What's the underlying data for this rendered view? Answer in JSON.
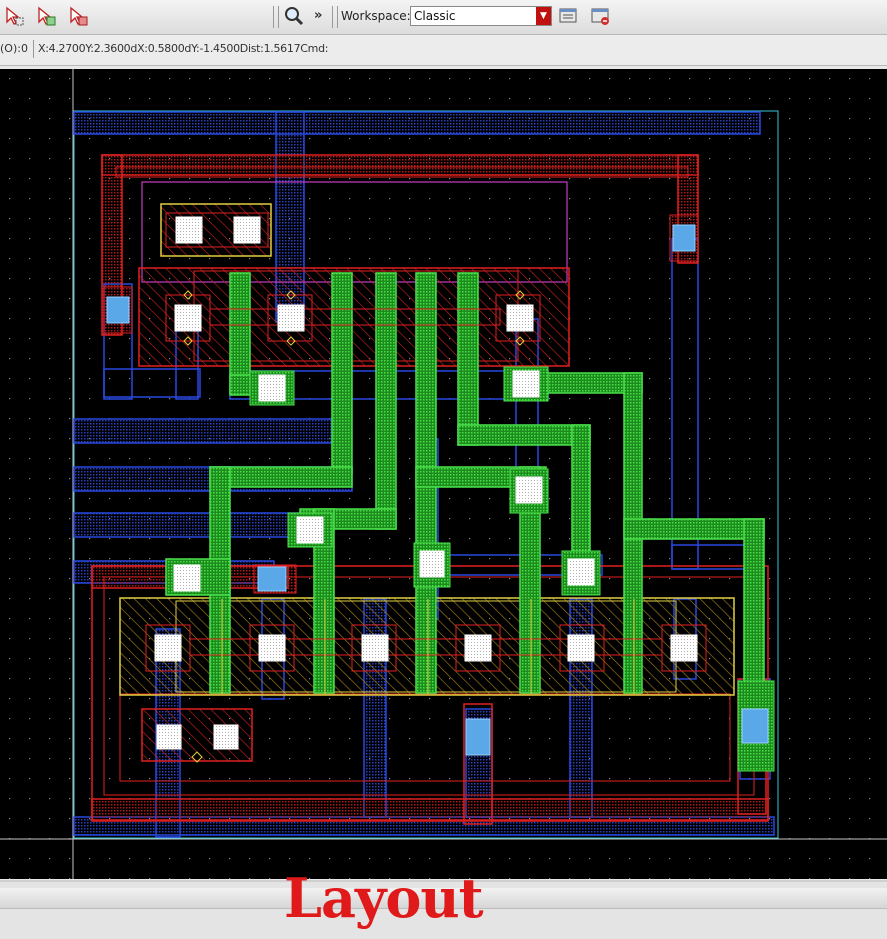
{
  "toolbar": {
    "icons": [
      "select-pointer-icon",
      "select-pointer-add-icon",
      "select-pointer-remove-icon",
      "zoom-icon",
      "workspace-save-icon",
      "workspace-load-icon"
    ],
    "overflow_label": "»",
    "workspace_label": "Workspace:",
    "workspace_value": "Classic"
  },
  "status": {
    "mode": "(O):0",
    "coords": "X:4.2700Y:2.3600dX:0.5800dY:-1.4500Dist:1.5617Cmd:"
  },
  "caption": "Layout",
  "colors": {
    "poly": "#e02020",
    "metal1": "#1f3fd0",
    "metal2": "#2ec82e",
    "nwell": "#c040c0",
    "boundary": "#40d0e0",
    "contact": "#ffffff",
    "via": "#5aa8e8",
    "active": "#e0d040"
  }
}
